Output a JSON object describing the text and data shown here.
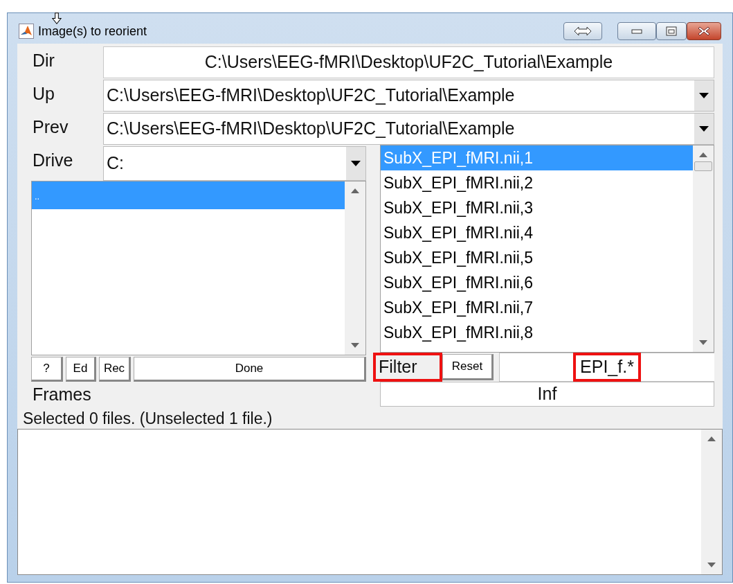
{
  "window": {
    "title": "Image(s) to reorient"
  },
  "fields": [
    {
      "label": "Dir",
      "kind": "text",
      "value": "C:\\Users\\EEG-fMRI\\Desktop\\UF2C_Tutorial\\Example"
    },
    {
      "label": "Up",
      "kind": "dropdown",
      "value": "C:\\Users\\EEG-fMRI\\Desktop\\UF2C_Tutorial\\Example"
    },
    {
      "label": "Prev",
      "kind": "dropdown",
      "value": "C:\\Users\\EEG-fMRI\\Desktop\\UF2C_Tutorial\\Example"
    }
  ],
  "drive": {
    "label": "Drive",
    "value": "C:"
  },
  "directories": [
    {
      "name": "..",
      "selected": true
    }
  ],
  "files": [
    {
      "name": "SubX_EPI_fMRI.nii,1",
      "selected": true
    },
    {
      "name": "SubX_EPI_fMRI.nii,2",
      "selected": false
    },
    {
      "name": "SubX_EPI_fMRI.nii,3",
      "selected": false
    },
    {
      "name": "SubX_EPI_fMRI.nii,4",
      "selected": false
    },
    {
      "name": "SubX_EPI_fMRI.nii,5",
      "selected": false
    },
    {
      "name": "SubX_EPI_fMRI.nii,6",
      "selected": false
    },
    {
      "name": "SubX_EPI_fMRI.nii,7",
      "selected": false
    },
    {
      "name": "SubX_EPI_fMRI.nii,8",
      "selected": false
    }
  ],
  "buttons": [
    "?",
    "Ed",
    "Rec",
    "Done"
  ],
  "filter": {
    "label": "Filter",
    "label_highlighted": true,
    "reset": "Reset",
    "value": "EPI_f.*",
    "value_highlighted": true
  },
  "frames": {
    "label": "Frames",
    "value": "Inf"
  },
  "status": "Selected 0 files. (Unselected 1 file.)"
}
